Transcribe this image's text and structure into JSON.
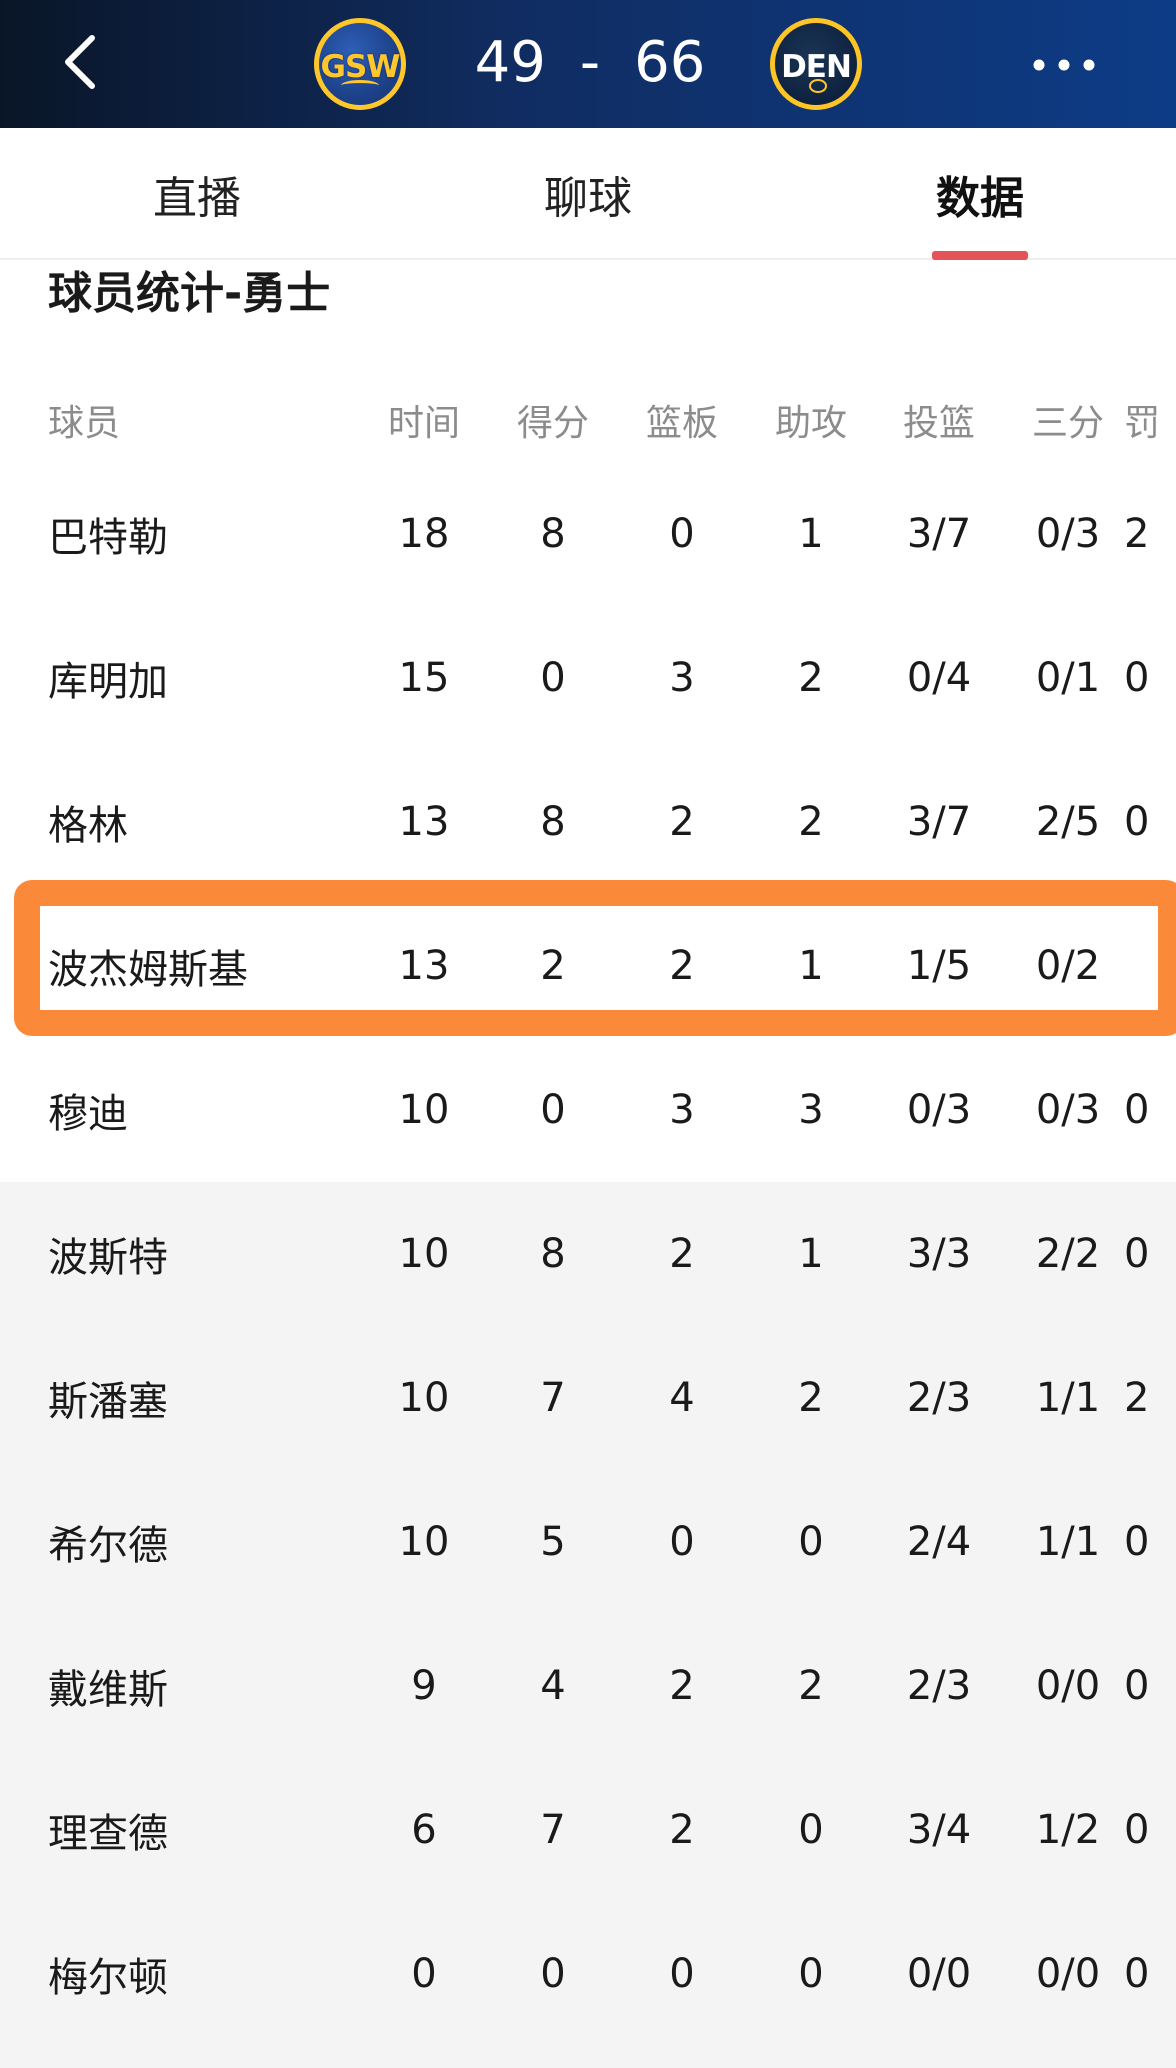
{
  "header": {
    "home_logo": "GSW",
    "away_logo": "DEN",
    "score_home": "49",
    "score_sep": "-",
    "score_away": "66",
    "back_icon": "chevron-left-icon",
    "more_icon": "more-horizontal-icon"
  },
  "tabs": [
    {
      "label": "直播",
      "active": false
    },
    {
      "label": "聊球",
      "active": false
    },
    {
      "label": "数据",
      "active": true
    }
  ],
  "colors": {
    "tab_indicator": "#e5525a",
    "highlight": "#fa8a39",
    "bench_background": "#f4f4f4"
  },
  "section": {
    "title": "球员统计-勇士"
  },
  "table": {
    "columns": [
      "球员",
      "时间",
      "得分",
      "篮板",
      "助攻",
      "投篮",
      "三分",
      "罚"
    ],
    "rows": [
      {
        "name": "巴特勒",
        "stats": [
          "18",
          "8",
          "0",
          "1",
          "3/7",
          "0/3",
          "2"
        ],
        "bench": false,
        "highlighted": false
      },
      {
        "name": "库明加",
        "stats": [
          "15",
          "0",
          "3",
          "2",
          "0/4",
          "0/1",
          "0"
        ],
        "bench": false,
        "highlighted": false
      },
      {
        "name": "格林",
        "stats": [
          "13",
          "8",
          "2",
          "2",
          "3/7",
          "2/5",
          "0"
        ],
        "bench": false,
        "highlighted": false
      },
      {
        "name": "波杰姆斯基",
        "stats": [
          "13",
          "2",
          "2",
          "1",
          "1/5",
          "0/2",
          ""
        ],
        "bench": false,
        "highlighted": true
      },
      {
        "name": "穆迪",
        "stats": [
          "10",
          "0",
          "3",
          "3",
          "0/3",
          "0/3",
          "0"
        ],
        "bench": false,
        "highlighted": false
      },
      {
        "name": "波斯特",
        "stats": [
          "10",
          "8",
          "2",
          "1",
          "3/3",
          "2/2",
          "0"
        ],
        "bench": true,
        "highlighted": false
      },
      {
        "name": "斯潘塞",
        "stats": [
          "10",
          "7",
          "4",
          "2",
          "2/3",
          "1/1",
          "2"
        ],
        "bench": true,
        "highlighted": false
      },
      {
        "name": "希尔德",
        "stats": [
          "10",
          "5",
          "0",
          "0",
          "2/4",
          "1/1",
          "0"
        ],
        "bench": true,
        "highlighted": false
      },
      {
        "name": "戴维斯",
        "stats": [
          "9",
          "4",
          "2",
          "2",
          "2/3",
          "0/0",
          "0"
        ],
        "bench": true,
        "highlighted": false
      },
      {
        "name": "理查德",
        "stats": [
          "6",
          "7",
          "2",
          "0",
          "3/4",
          "1/2",
          "0"
        ],
        "bench": true,
        "highlighted": false
      },
      {
        "name": "梅尔顿",
        "stats": [
          "0",
          "0",
          "0",
          "0",
          "0/0",
          "0/0",
          "0"
        ],
        "bench": true,
        "highlighted": false
      }
    ]
  }
}
